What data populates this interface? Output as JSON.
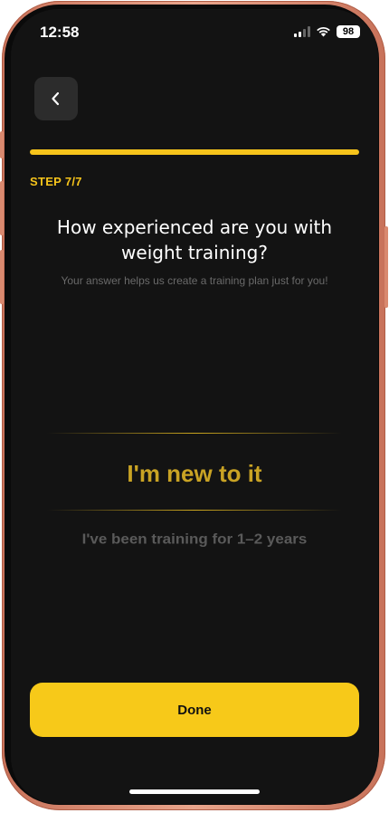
{
  "status_bar": {
    "time": "12:58",
    "battery": "98",
    "icons": [
      "signal-icon",
      "wifi-icon",
      "battery-icon"
    ]
  },
  "header": {
    "back_icon": "chevron-left-icon"
  },
  "progress": {
    "step_label": "STEP 7/7",
    "fraction": 1.0
  },
  "question": {
    "title": "How experienced are you with weight training?",
    "subtitle": "Your answer helps us create a training plan just for you!"
  },
  "picker": {
    "selected": "I'm new to it",
    "next_option": "I've been training for 1–2 years"
  },
  "footer": {
    "done_label": "Done"
  },
  "colors": {
    "accent": "#f6c41b",
    "background": "#131313",
    "frame": "#d9896f"
  }
}
